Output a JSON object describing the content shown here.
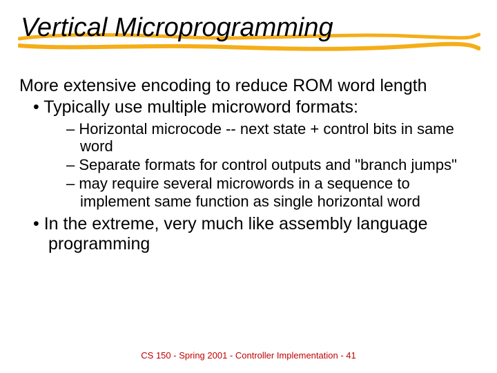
{
  "title": "Vertical Microprogramming",
  "lead": "More extensive encoding to reduce ROM word length",
  "bullets": [
    {
      "text": "Typically use multiple microword formats:",
      "sub": [
        "Horizontal microcode -- next state + control bits in same word",
        "Separate formats for control outputs and \"branch jumps\"",
        "may require several microwords in a sequence to implement same function as single horizontal word"
      ]
    },
    {
      "text": "In the extreme, very much like assembly language programming",
      "sub": []
    }
  ],
  "footer": "CS 150 - Spring 2001 - Controller Implementation - 41",
  "accent_color": "#f5a500"
}
